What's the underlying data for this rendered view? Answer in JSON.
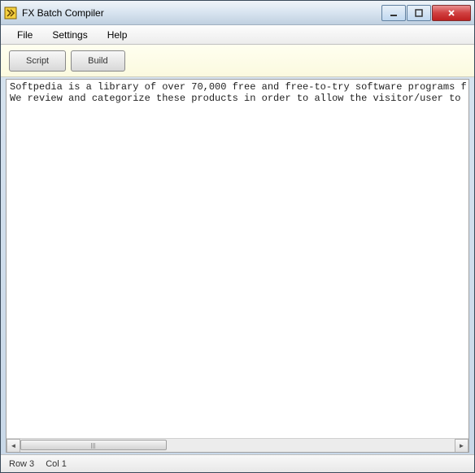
{
  "window": {
    "title": "FX Batch Compiler"
  },
  "menubar": {
    "file": "File",
    "settings": "Settings",
    "help": "Help"
  },
  "toolbar": {
    "script": "Script",
    "build": "Build"
  },
  "editor": {
    "line1": "Softpedia is a library of over 70,000 free and free-to-try software programs f",
    "line2": "We review and categorize these products in order to allow the visitor/user to "
  },
  "statusbar": {
    "row": "Row 3",
    "col": "Col 1"
  }
}
